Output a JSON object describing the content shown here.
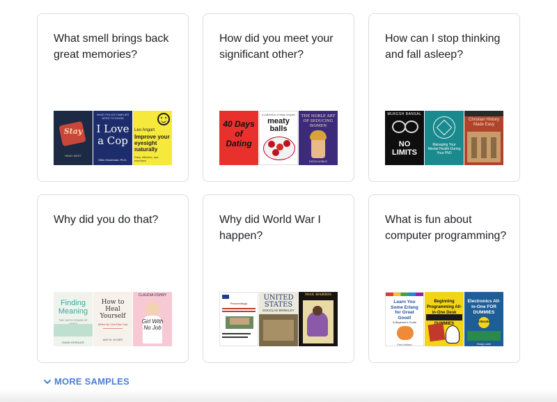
{
  "cards": [
    {
      "question": "What smell brings back great memories?",
      "books": [
        {
          "title": "Stay",
          "subtitle": "HEAD WEST",
          "author": ""
        },
        {
          "title": "I Love a Cop",
          "subtitle": "WHAT POLICE FAMILIES NEED TO KNOW",
          "author": "Ellen Kirschman, Ph.D."
        },
        {
          "title": "Improve your eyesight naturally",
          "subtitle": "Easy, effective, eye-exercises",
          "author": "Leo Angart"
        }
      ]
    },
    {
      "question": "How did you meet your significant other?",
      "books": [
        {
          "title": "40 Days of Dating",
          "subtitle": "",
          "author": ""
        },
        {
          "title": "meaty balls",
          "subtitle": "a collection of tasty recipes",
          "author": ""
        },
        {
          "title": "THE NOBLE ART OF SEDUCING WOMEN",
          "subtitle": "",
          "author": "DIZZA NOBLE"
        }
      ]
    },
    {
      "question": "How can I stop thinking and fall asleep?",
      "books": [
        {
          "title": "NO LIMITS",
          "subtitle": "",
          "author": "MUKESH BANSAL"
        },
        {
          "title": "Managing Your Mental Health During Your PhD",
          "subtitle": "",
          "author": ""
        },
        {
          "title": "Christian History Made Easy",
          "subtitle": "",
          "author": ""
        }
      ]
    },
    {
      "question": "Why did you do that?",
      "books": [
        {
          "title": "Finding Meaning",
          "subtitle": "THE SIXTH STAGE OF GRIEF",
          "author": "DAVID KESSLER"
        },
        {
          "title": "How to Heal Yourself",
          "subtitle": "When No One Else Can",
          "author": "AMY B. SCHER"
        },
        {
          "title": "Girl With No Job",
          "subtitle": "",
          "author": "CLAUDIA OSHRY"
        }
      ]
    },
    {
      "question": "Why did World War I happen?",
      "books": [
        {
          "title": "Proceedings",
          "subtitle": "",
          "author": ""
        },
        {
          "title": "UNITED STATES",
          "subtitle": "",
          "author": "DOUGLAS BRINKLEY"
        },
        {
          "title": "MAX HARRIS",
          "subtitle": "",
          "author": ""
        }
      ]
    },
    {
      "question": "What is fun about computer programming?",
      "books": [
        {
          "title": "Learn You Some Erlang for Great Good!",
          "subtitle": "A Beginner's Guide",
          "author": "Fred Hébert"
        },
        {
          "title": "Beginning Programming All-in-One Desk Reference FOR DUMMIES",
          "subtitle": "",
          "author": ""
        },
        {
          "title": "Electronics All-in-One FOR DUMMIES",
          "subtitle": "9 Books",
          "author": "Doug Lowe"
        }
      ]
    }
  ],
  "more_samples": {
    "label": "MORE SAMPLES",
    "icon": "chevron-down-icon"
  },
  "colors": {
    "accent": "#4a7fd4",
    "card_border": "#dadce0",
    "text": "#202124"
  }
}
